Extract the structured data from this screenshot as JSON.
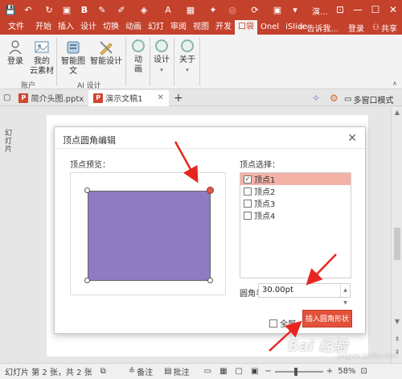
{
  "titlebar": {
    "quick_access": [
      "save-icon",
      "undo-icon",
      "redo-icon",
      "format-painter-icon",
      "bold-b-icon",
      "brush-icon",
      "font-color-a-icon",
      "format-icon",
      "paint-icon",
      "shape-icon",
      "image-icon",
      "refresh-icon"
    ],
    "doc_title": "演...",
    "bg_color": "#c4412b"
  },
  "ribbon_tabs": {
    "items": [
      {
        "label": "文件"
      },
      {
        "label": "开始"
      },
      {
        "label": "插入"
      },
      {
        "label": "设计"
      },
      {
        "label": "切换"
      },
      {
        "label": "动画"
      },
      {
        "label": "幻灯"
      },
      {
        "label": "审阅"
      },
      {
        "label": "视图"
      },
      {
        "label": "开发"
      },
      {
        "label": "口袋"
      },
      {
        "label": "Onel"
      },
      {
        "label": "iSlide"
      }
    ],
    "active": "口袋",
    "tell_me": "告诉我...",
    "login": "登录",
    "share": "共享"
  },
  "ribbon": {
    "login": "登录",
    "my_materials": [
      "我的",
      "云素材"
    ],
    "account_group": "账户",
    "smart_text": "智能图文",
    "smart_design": "智能设计",
    "ai_group": "AI 设计",
    "animation": [
      "动",
      "画"
    ],
    "design": "设计",
    "about": "关于"
  },
  "doc_tabs": {
    "items": [
      {
        "label": "简介头图.pptx",
        "active": false
      },
      {
        "label": "演示文稿1",
        "active": true
      }
    ],
    "multi_window": "多窗口模式"
  },
  "left_pane": {
    "label": "幻灯片"
  },
  "dialog": {
    "title": "顶点圆角编辑",
    "preview_label": "顶点预览：",
    "vertex_label": "顶点选择：",
    "vertices": [
      {
        "label": "顶点1",
        "checked": true
      },
      {
        "label": "顶点2",
        "checked": false
      },
      {
        "label": "顶点3",
        "checked": false
      },
      {
        "label": "顶点4",
        "checked": false
      }
    ],
    "radius_label": "圆角半径：",
    "radius_value": "30.00pt",
    "all_label": "全部",
    "insert_button": "插入圆角形状",
    "shape_color": "#8e7cc3",
    "accent_color": "#e3513a"
  },
  "status": {
    "slide_info": "幻灯片 第 2 张，共 2 张",
    "notes": "备注",
    "comments": "批注",
    "zoom": "58%"
  },
  "watermark": {
    "text": "Bai 经验",
    "sub": "jingyan.baidu.com"
  }
}
